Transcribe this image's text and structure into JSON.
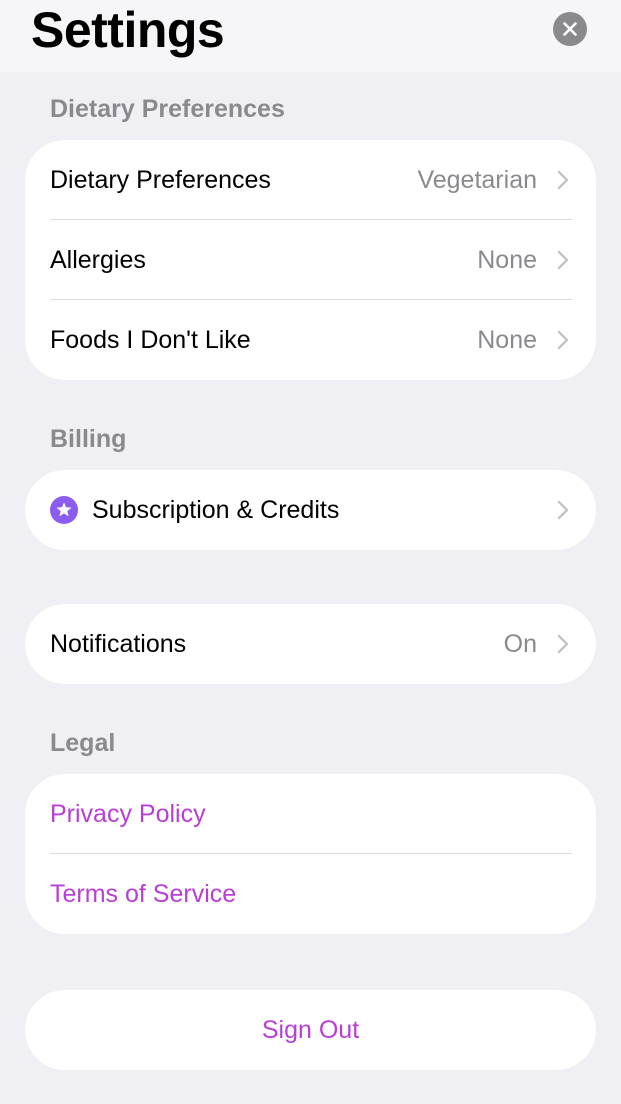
{
  "header": {
    "title": "Settings"
  },
  "sections": {
    "dietary": {
      "header": "Dietary Preferences",
      "rows": [
        {
          "label": "Dietary Preferences",
          "value": "Vegetarian"
        },
        {
          "label": "Allergies",
          "value": "None"
        },
        {
          "label": "Foods I Don't Like",
          "value": "None"
        }
      ]
    },
    "billing": {
      "header": "Billing",
      "subscription_label": "Subscription & Credits"
    },
    "notifications": {
      "label": "Notifications",
      "value": "On"
    },
    "legal": {
      "header": "Legal",
      "privacy_label": "Privacy Policy",
      "terms_label": "Terms of Service"
    }
  },
  "sign_out_label": "Sign Out",
  "colors": {
    "accent": "#b83fd6",
    "star_icon": "#8a5cf0",
    "secondary_text": "#8a8a8e",
    "background": "#efeff4"
  },
  "icons": {
    "close": "close-icon",
    "chevron": "chevron-right-icon",
    "subscription": "star-badge-icon"
  }
}
